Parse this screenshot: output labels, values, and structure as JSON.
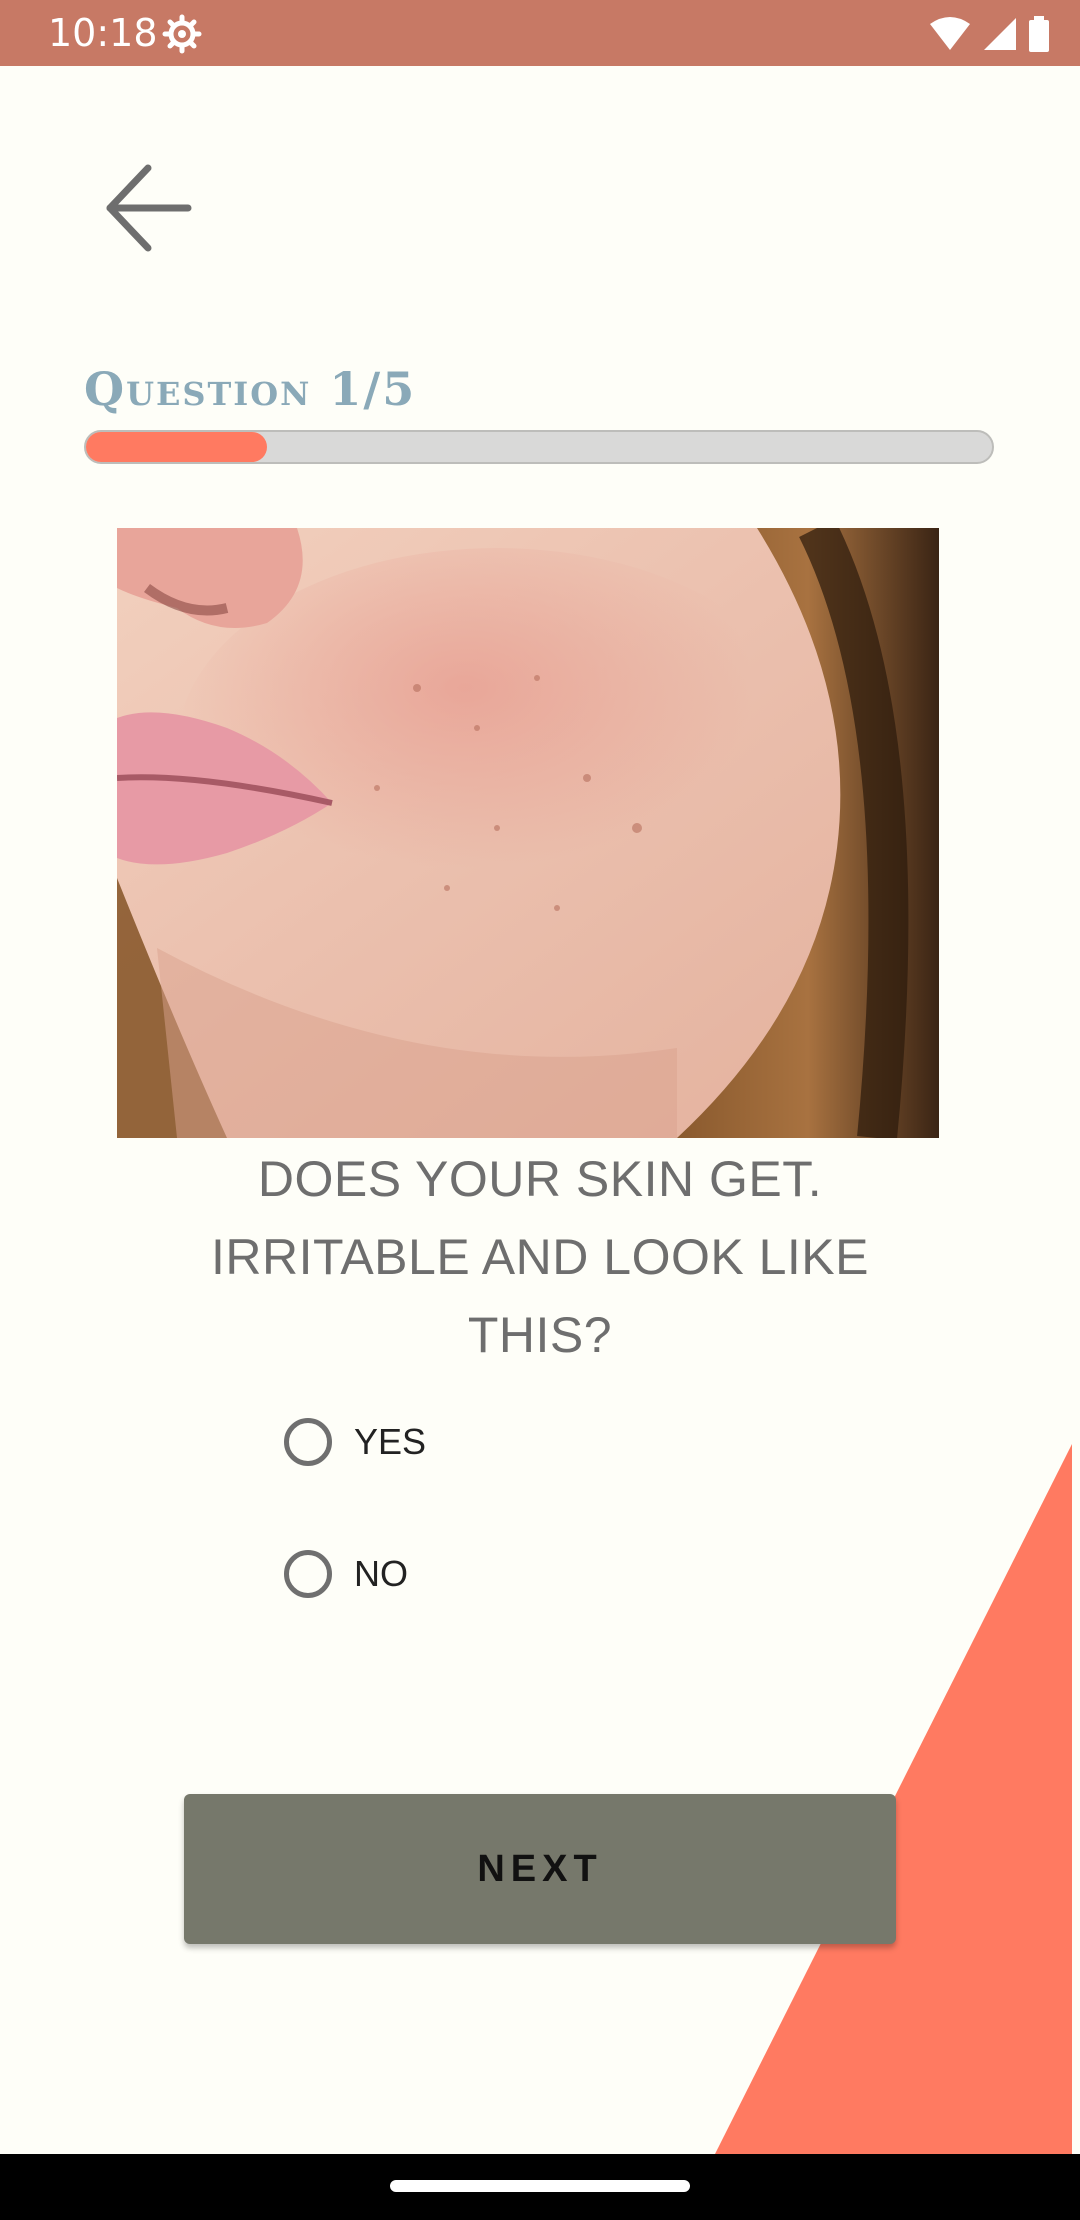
{
  "status_bar": {
    "time": "10:18",
    "icons": [
      "settings-gear-icon",
      "wifi-icon",
      "cell-signal-icon",
      "battery-icon"
    ],
    "background": "#C77965"
  },
  "header": {
    "back_icon": "arrow-left-icon"
  },
  "quiz": {
    "question_label": "Question 1/5",
    "progress": 0.2,
    "progress_color": "#FF7A61",
    "question_lines": [
      "DOES YOUR SKIN GET.",
      "IRRITABLE AND LOOK LIKE",
      "THIS?"
    ],
    "options": [
      {
        "label": "YES",
        "selected": false
      },
      {
        "label": "NO",
        "selected": false
      }
    ],
    "next_label": "NEXT"
  },
  "colors": {
    "background": "#FEFEF8",
    "accent": "#FF7A61",
    "button": "#76786B"
  }
}
